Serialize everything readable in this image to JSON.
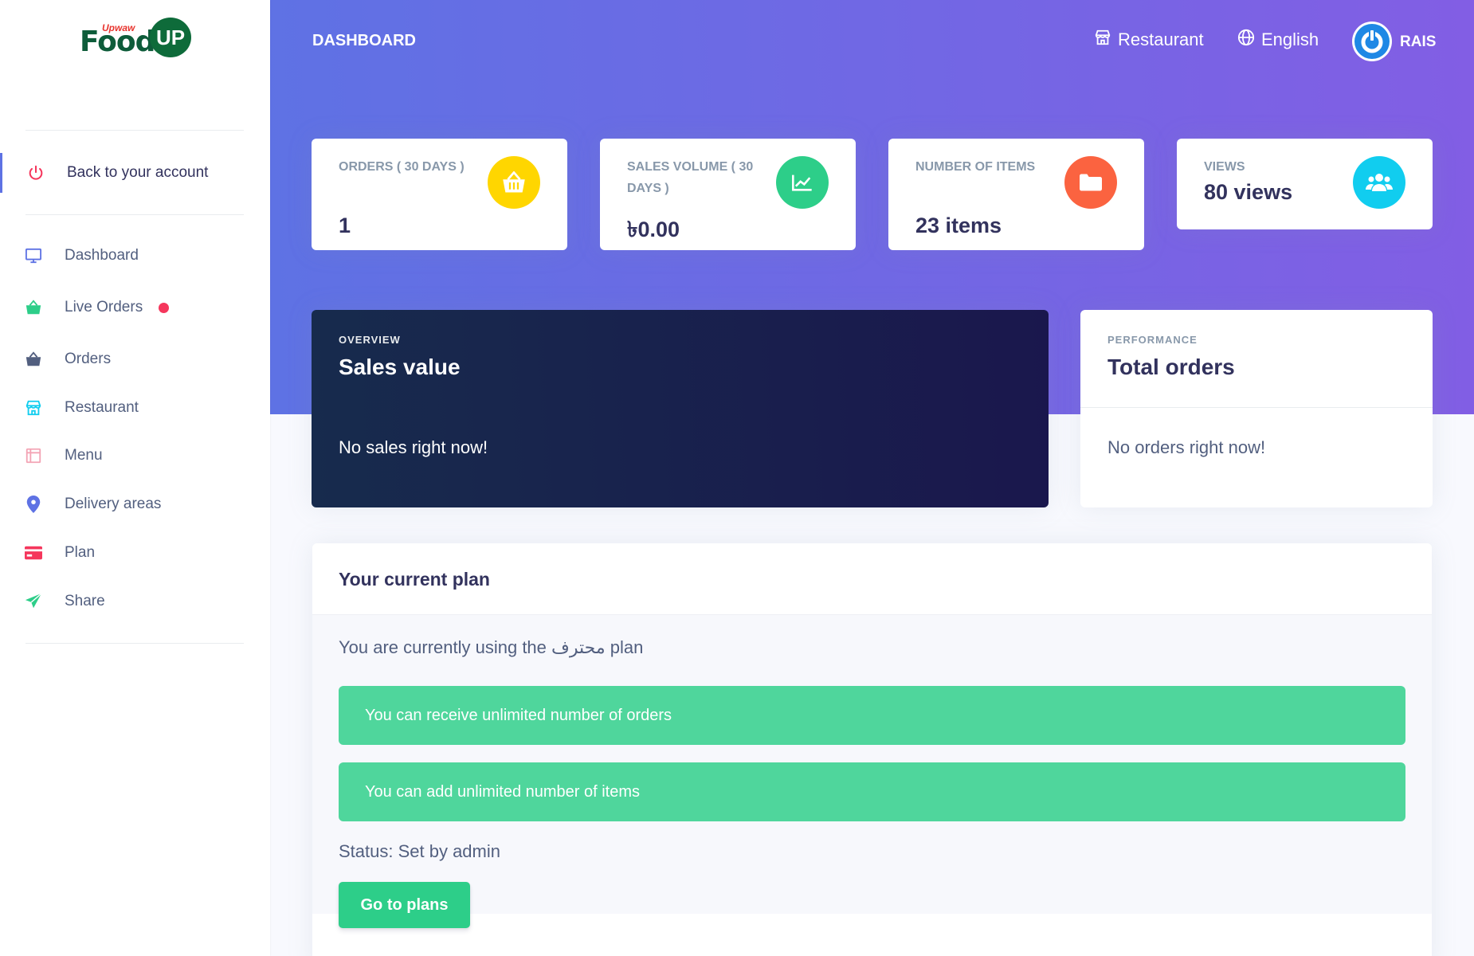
{
  "brand": {
    "small": "Upwaw",
    "main": "Food",
    "badge": "UP"
  },
  "sidebar": {
    "back_label": "Back to your account",
    "items": [
      {
        "label": "Dashboard",
        "icon": "monitor-icon",
        "color": "#5e72e4"
      },
      {
        "label": "Live Orders",
        "icon": "basket-icon",
        "color": "#2dce89"
      },
      {
        "label": "Orders",
        "icon": "basket-icon",
        "color": "#525f7f"
      },
      {
        "label": "Restaurant",
        "icon": "shop-icon",
        "color": "#11cdef"
      },
      {
        "label": "Menu",
        "icon": "menu-icon",
        "color": "#f3a4b5"
      },
      {
        "label": "Delivery areas",
        "icon": "pin-icon",
        "color": "#5e72e4"
      },
      {
        "label": "Plan",
        "icon": "credit-card-icon",
        "color": "#f5365c"
      },
      {
        "label": "Share",
        "icon": "send-icon",
        "color": "#2dce89"
      }
    ]
  },
  "topbar": {
    "title": "DASHBOARD",
    "restaurant_label": "Restaurant",
    "language_label": "English",
    "user_name": "RAIS"
  },
  "stats": [
    {
      "title": "ORDERS ( 30 DAYS )",
      "value": "1",
      "icon": "basket-icon",
      "color": "#ffd600"
    },
    {
      "title": "SALES VOLUME ( 30 DAYS )",
      "value": "৳0.00",
      "icon": "chart-icon",
      "color": "#2dce89"
    },
    {
      "title": "NUMBER OF ITEMS",
      "value": "23 items",
      "icon": "folder-icon",
      "color": "#fb6340"
    },
    {
      "title": "VIEWS",
      "value": "80 views",
      "icon": "users-icon",
      "color": "#11cdef"
    }
  ],
  "sales": {
    "eyebrow": "OVERVIEW",
    "title": "Sales value",
    "empty": "No sales right now!"
  },
  "performance": {
    "eyebrow": "PERFORMANCE",
    "title": "Total orders",
    "empty": "No orders right now!"
  },
  "plan": {
    "title": "Your current plan",
    "text": "You are currently using the محترف plan",
    "alerts": [
      "You can receive unlimited number of orders",
      "You can add unlimited number of items"
    ],
    "status": "Status: Set by admin",
    "button": "Go to plans"
  },
  "colors": {
    "primary": "#5e72e4",
    "gradient_end": "#825ee4",
    "success": "#2dce89",
    "alert": "#4fd69c"
  }
}
